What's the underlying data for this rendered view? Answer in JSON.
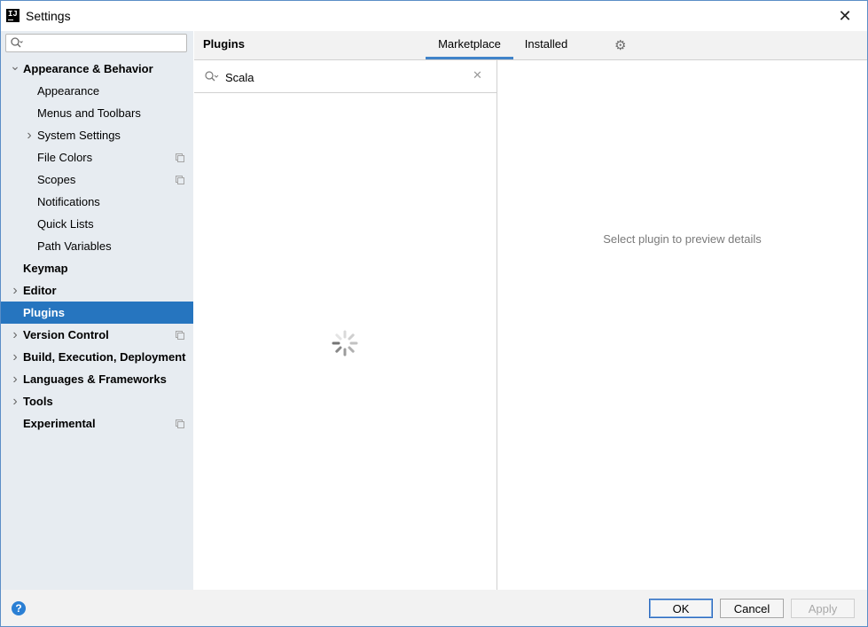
{
  "window": {
    "title": "Settings"
  },
  "sidebar": {
    "search_value": "",
    "items": [
      {
        "label": "Appearance & Behavior",
        "level": 0,
        "bold": true,
        "chevron": "down",
        "copy": false,
        "selected": false
      },
      {
        "label": "Appearance",
        "level": 1,
        "bold": false,
        "chevron": "",
        "copy": false,
        "selected": false
      },
      {
        "label": "Menus and Toolbars",
        "level": 1,
        "bold": false,
        "chevron": "",
        "copy": false,
        "selected": false
      },
      {
        "label": "System Settings",
        "level": 1,
        "bold": false,
        "chevron": "right",
        "copy": false,
        "selected": false
      },
      {
        "label": "File Colors",
        "level": 1,
        "bold": false,
        "chevron": "",
        "copy": true,
        "selected": false
      },
      {
        "label": "Scopes",
        "level": 1,
        "bold": false,
        "chevron": "",
        "copy": true,
        "selected": false
      },
      {
        "label": "Notifications",
        "level": 1,
        "bold": false,
        "chevron": "",
        "copy": false,
        "selected": false
      },
      {
        "label": "Quick Lists",
        "level": 1,
        "bold": false,
        "chevron": "",
        "copy": false,
        "selected": false
      },
      {
        "label": "Path Variables",
        "level": 1,
        "bold": false,
        "chevron": "",
        "copy": false,
        "selected": false
      },
      {
        "label": "Keymap",
        "level": 0,
        "bold": true,
        "chevron": "",
        "copy": false,
        "selected": false
      },
      {
        "label": "Editor",
        "level": 0,
        "bold": true,
        "chevron": "right",
        "copy": false,
        "selected": false
      },
      {
        "label": "Plugins",
        "level": 0,
        "bold": true,
        "chevron": "",
        "copy": false,
        "selected": true
      },
      {
        "label": "Version Control",
        "level": 0,
        "bold": true,
        "chevron": "right",
        "copy": true,
        "selected": false
      },
      {
        "label": "Build, Execution, Deployment",
        "level": 0,
        "bold": true,
        "chevron": "right",
        "copy": false,
        "selected": false
      },
      {
        "label": "Languages & Frameworks",
        "level": 0,
        "bold": true,
        "chevron": "right",
        "copy": false,
        "selected": false
      },
      {
        "label": "Tools",
        "level": 0,
        "bold": true,
        "chevron": "right",
        "copy": false,
        "selected": false
      },
      {
        "label": "Experimental",
        "level": 0,
        "bold": true,
        "chevron": "",
        "copy": true,
        "selected": false
      }
    ]
  },
  "header": {
    "title": "Plugins",
    "tabs": [
      {
        "label": "Marketplace",
        "active": true
      },
      {
        "label": "Installed",
        "active": false
      }
    ]
  },
  "plugins": {
    "search_value": "Scala",
    "details_placeholder": "Select plugin to preview details"
  },
  "footer": {
    "ok_label": "OK",
    "cancel_label": "Cancel",
    "apply_label": "Apply"
  },
  "colors": {
    "selection": "#2675bf",
    "sidebar_bg": "#e7ecf1",
    "tab_underline": "#4083c9"
  }
}
